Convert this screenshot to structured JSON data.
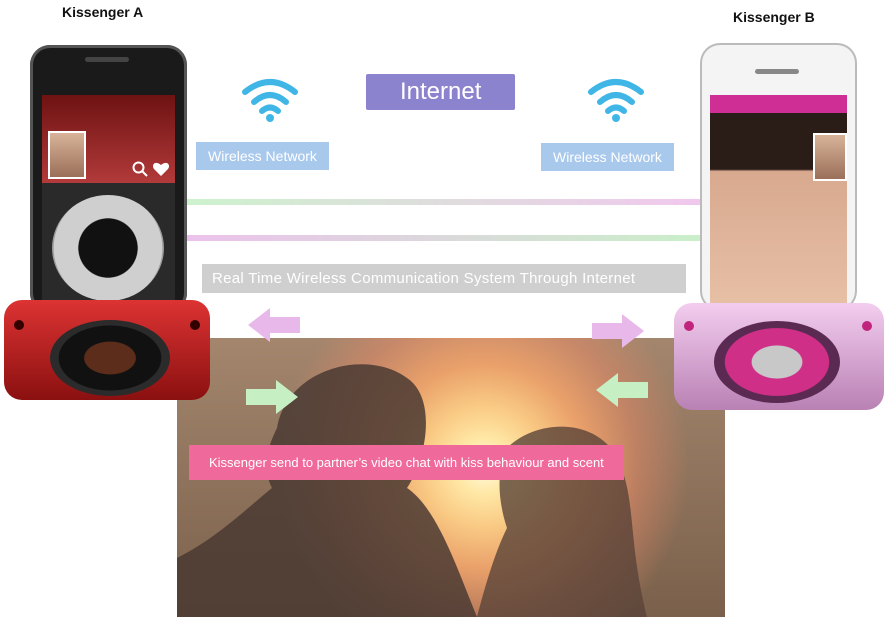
{
  "labels": {
    "device_a": "Kissenger A",
    "device_b": "Kissenger B",
    "internet": "Internet",
    "wireless_left": "Wireless Network",
    "wireless_right": "Wireless Network",
    "communication": "Real Time Wireless Communication System Through Internet",
    "caption": "Kissenger send to partner’s video chat with kiss behaviour and scent"
  },
  "icons": {
    "wifi": "wifi-icon",
    "search": "search-icon",
    "heart": "heart-icon"
  },
  "colors": {
    "internet_box": "#8c83cf",
    "wireless_box": "#a9c9ec",
    "comm_box": "#cfcfcf",
    "caption_box": "#ef6a9a",
    "wifi": "#3fb6e6",
    "device_a": "#c0282a",
    "device_b": "#e9b4e0",
    "arrow_pink": "#e9b8ea",
    "arrow_green": "#c6efc4"
  }
}
